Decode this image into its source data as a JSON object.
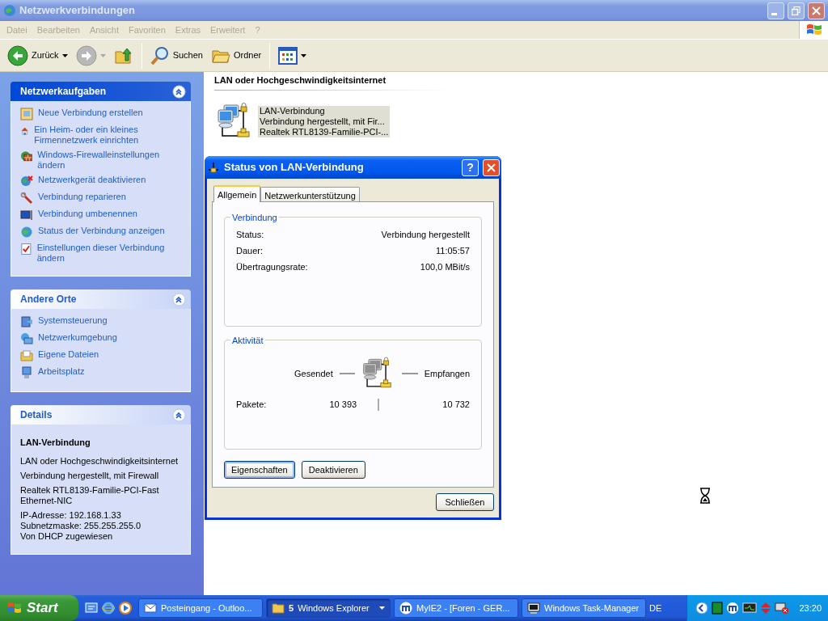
{
  "window": {
    "title": "Netzwerkverbindungen"
  },
  "menu": [
    {
      "label": "Datei",
      "disabled": true
    },
    {
      "label": "Bearbeiten",
      "disabled": true
    },
    {
      "label": "Ansicht",
      "disabled": true
    },
    {
      "label": "Favoriten",
      "disabled": true
    },
    {
      "label": "Extras",
      "disabled": true
    },
    {
      "label": "Erweitert",
      "disabled": true
    },
    {
      "label": "?",
      "disabled": true
    }
  ],
  "toolbar": [
    {
      "kind": "back",
      "label": "Zurück",
      "disabled": false
    },
    {
      "kind": "forward",
      "disabled": true
    },
    {
      "kind": "up",
      "disabled": false
    },
    {
      "kind": "separator"
    },
    {
      "kind": "search",
      "label": "Suchen",
      "disabled": false
    },
    {
      "kind": "folders",
      "label": "Ordner",
      "disabled": false
    },
    {
      "kind": "separator"
    },
    {
      "kind": "views",
      "disabled": false
    }
  ],
  "sidebar": {
    "panels": [
      {
        "title": "Netzwerkaufgaben",
        "kind": "tasks",
        "expanded": true,
        "items": [
          "Neue Verbindung erstellen",
          "Ein Heim- oder ein kleines Firmennetzwerk einrichten",
          "Windows-Firewalleinstellungen ändern",
          "Netzwerkgerät deaktivieren",
          "Verbindung reparieren",
          "Verbindung umbenennen",
          "Status der Verbindung anzeigen",
          "Einstellungen dieser Verbindung ändern"
        ]
      },
      {
        "title": "Andere Orte",
        "kind": "places",
        "expanded": true,
        "items": [
          "Systemsteuerung",
          "Netzwerkumgebung",
          "Eigene Dateien",
          "Arbeitsplatz"
        ]
      },
      {
        "title": "Details",
        "kind": "details",
        "expanded": true,
        "heading": "LAN-Verbindung",
        "paragraphs": [
          [
            "LAN oder Hochgeschwindigkeitsinternet"
          ],
          [
            "Verbindung hergestellt, mit Firewall"
          ],
          [
            "Realtek RTL8139-Familie-PCI-Fast Ethernet-NIC"
          ],
          [
            "IP-Adresse: 192.168.1.33",
            "Subnetzmaske: 255.255.255.0",
            "Von DHCP zugewiesen"
          ]
        ]
      }
    ]
  },
  "content": {
    "group_title": "LAN oder Hochgeschwindigkeitsinternet",
    "items": [
      {
        "lines": [
          "LAN-Verbindung",
          "Verbindung hergestellt, mit Fir...",
          "Realtek RTL8139-Familie-PCI-..."
        ],
        "selected": true
      }
    ]
  },
  "dialog": {
    "title": "Status von LAN-Verbindung",
    "help": "?",
    "tabs": [
      {
        "label": "Allgemein",
        "selected": true
      },
      {
        "label": "Netzwerkunterstützung",
        "selected": false
      }
    ],
    "connection": {
      "title": "Verbindung",
      "rows": [
        {
          "label": "Status:",
          "value": "Verbindung hergestellt"
        },
        {
          "label": "Dauer:",
          "value": "11:05:57"
        },
        {
          "label": "Übertragungsrate:",
          "value": "100,0 MBit/s"
        }
      ]
    },
    "activity": {
      "title": "Aktivität",
      "sent_label": "Gesendet",
      "received_label": "Empfangen",
      "packets_label": "Pakete:",
      "sent": "10 393",
      "received": "10 732"
    },
    "buttons": [
      {
        "label": "Eigenschaften",
        "focused": true
      },
      {
        "label": "Deaktivieren",
        "focused": false
      }
    ],
    "close_button": "Schließen"
  },
  "taskbar": {
    "start": "Start",
    "tasks": [
      {
        "label": "Posteingang - Outloo...",
        "selected": false,
        "kind": "mail"
      },
      {
        "count": "5",
        "label": "Windows Explorer",
        "selected": true,
        "kind": "group"
      },
      {
        "label": "MyIE2 - [Foren - GER...",
        "selected": false,
        "kind": "browser"
      },
      {
        "label": "Windows Task-Manager",
        "selected": false,
        "kind": "monitor"
      }
    ],
    "language": "DE",
    "clock": "23:20"
  }
}
